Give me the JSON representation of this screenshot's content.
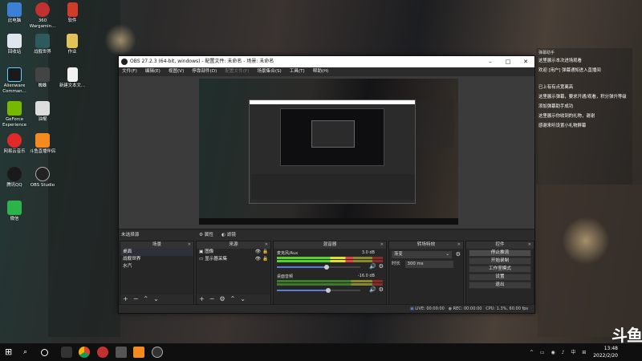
{
  "desktop": {
    "icons": [
      {
        "label": "此电脑"
      },
      {
        "label": "360 Wargamin..."
      },
      {
        "label": "软件"
      },
      {
        "label": "回收站"
      },
      {
        "label": "战舰世界"
      },
      {
        "label": "作业"
      },
      {
        "label": "Alienware Comman..."
      },
      {
        "label": "蜘蛛"
      },
      {
        "label": "新建文本文..."
      },
      {
        "label": "GeForce Experience"
      },
      {
        "label": "油棍"
      },
      {
        "label": "网易云音乐"
      },
      {
        "label": "斗鱼直播伴侣"
      },
      {
        "label": "腾讯QQ"
      },
      {
        "label": "OBS Studio"
      },
      {
        "label": "微信"
      }
    ]
  },
  "obs": {
    "title": "OBS 27.2.3 (64-bit, windows) - 配置文件: 未命名 - 场景: 未命名",
    "menu": [
      "文件(F)",
      "编辑(E)",
      "视图(V)",
      "停靠部件(D)",
      "配置文件(P)",
      "场景集合(S)",
      "工具(T)",
      "帮助(H)"
    ],
    "no_source": "未选择源",
    "scene_toolbar": {
      "properties": "属性",
      "filters": "滤镜"
    },
    "docks": {
      "scenes": {
        "title": "场景",
        "items": [
          "桌面",
          "战舰世界",
          "水汽"
        ]
      },
      "sources": {
        "title": "来源",
        "items": [
          "图像",
          "显示器采集"
        ]
      },
      "mixer": {
        "title": "混音器",
        "channels": [
          {
            "name": "麦克风/Aux",
            "db": "3.0 dB",
            "level": 0.72,
            "volume": 0.6
          },
          {
            "name": "桌面音频",
            "db": "-16.0 dB",
            "level": 0.0,
            "volume": 0.62
          }
        ]
      },
      "transitions": {
        "title": "转场特效",
        "type": "渐变",
        "duration_label": "时长",
        "duration": "300 ms"
      },
      "controls": {
        "title": "控件",
        "buttons": [
          "停止推流",
          "开始录制",
          "工作室模式",
          "设置",
          "退出"
        ]
      }
    },
    "status": {
      "live": "LIVE: 00:00:00",
      "rec": "REC: 00:00:00",
      "cpu": "CPU: 1.3%, 60.00 fps"
    }
  },
  "chat": {
    "title": "弹幕助手",
    "lines": [
      "这里展示本次进场观看",
      "欢迎 [用户] 弹幕通知进入直播间",
      "已上有有点宽离高",
      "这里展示弹幕，要求开通/观看，积分弹升等级",
      "添加弹幕助手成功",
      "这里展示你收到的礼物，谢谢",
      "感谢来听设置小礼物屏幕"
    ]
  },
  "taskbar": {
    "time": "13:48",
    "date": "2022/2/20"
  },
  "watermark": "斗鱼"
}
